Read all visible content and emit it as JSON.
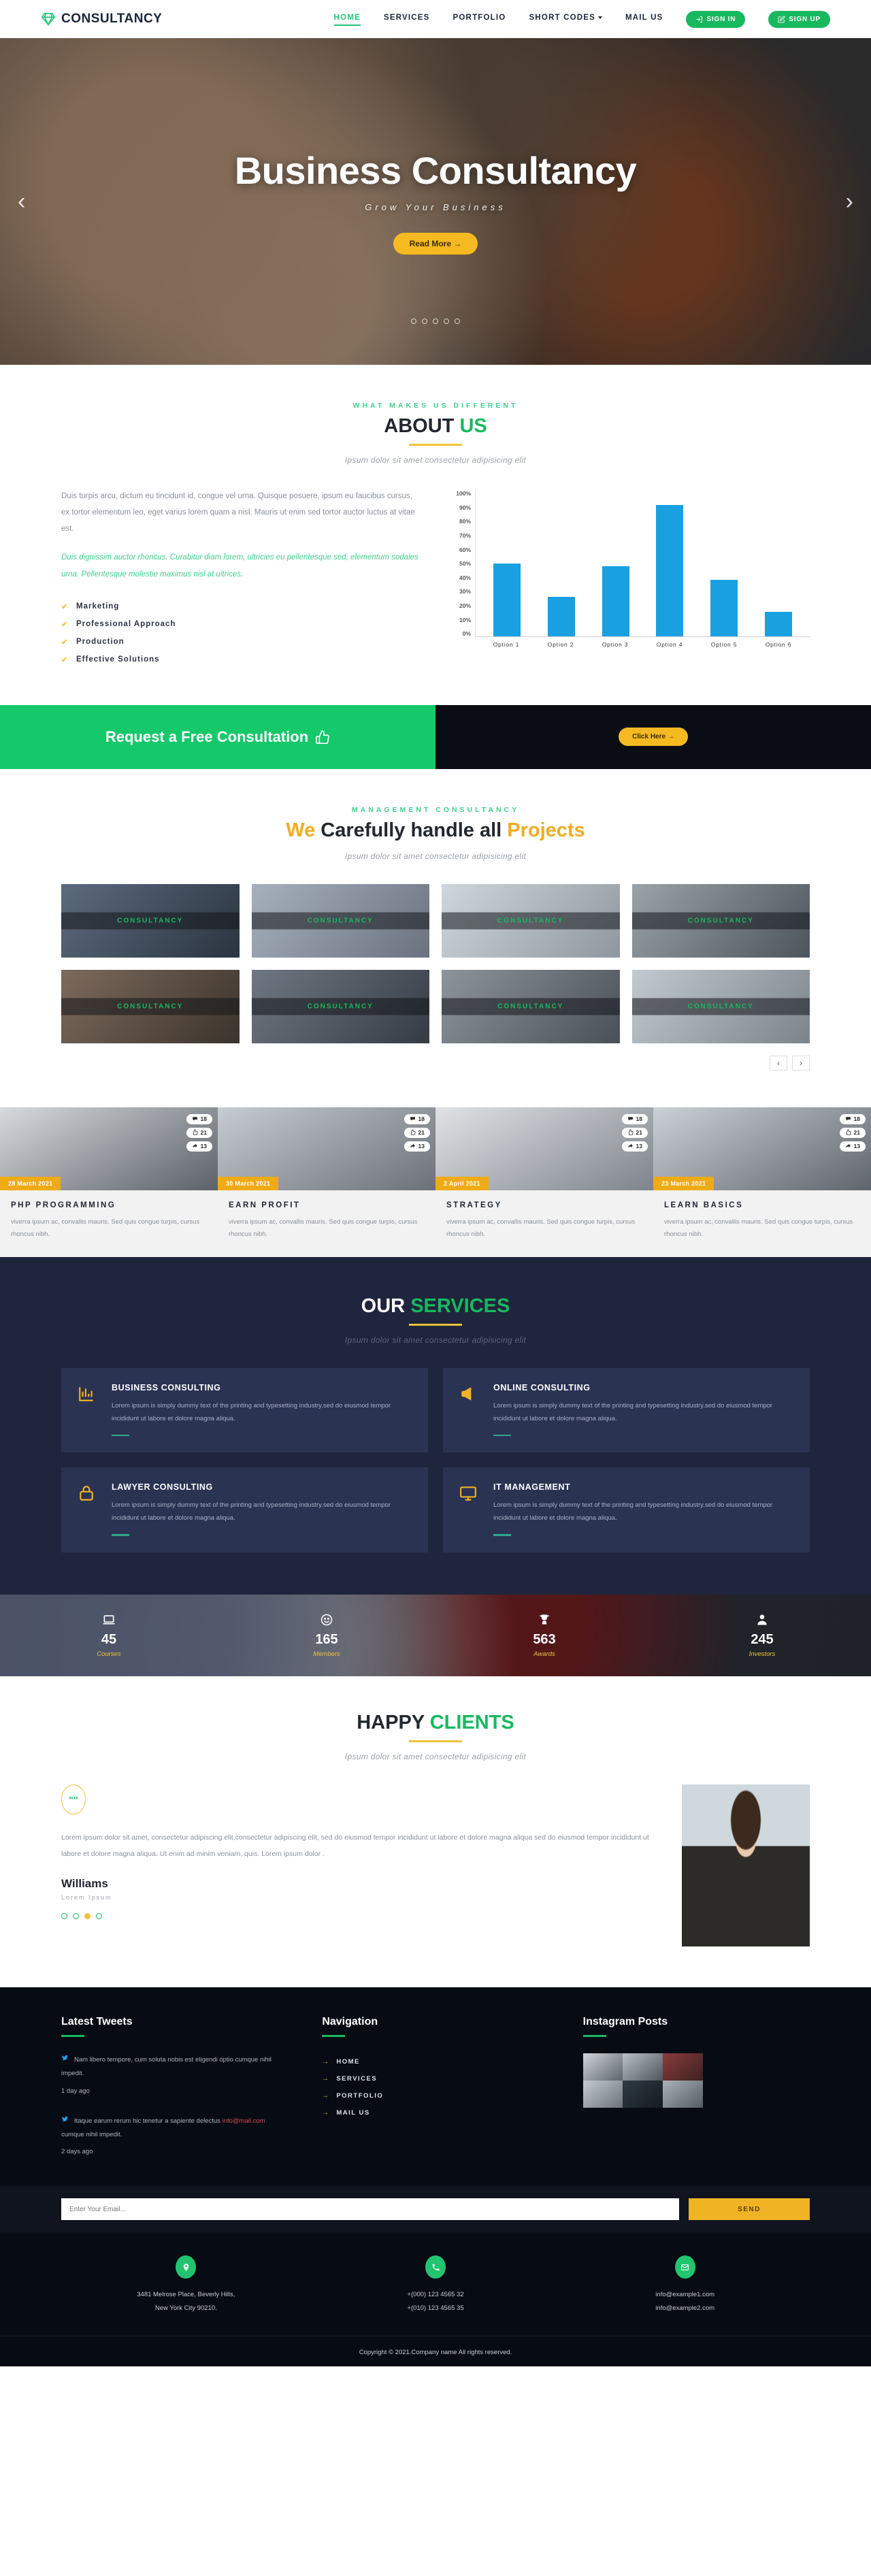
{
  "header": {
    "brand": "CONSULTANCY",
    "brand_icon": "diamond-icon",
    "nav": [
      {
        "label": "HOME",
        "active": true
      },
      {
        "label": "SERVICES",
        "active": false
      },
      {
        "label": "PORTFOLIO",
        "active": false
      },
      {
        "label": "SHORT CODES",
        "active": false,
        "dropdown": true
      },
      {
        "label": "MAIL US",
        "active": false
      }
    ],
    "sign_in": "SIGN IN",
    "sign_up": "SIGN UP"
  },
  "hero": {
    "title": "Business Consultancy",
    "subtitle": "Grow Your Business",
    "button": "Read More",
    "prev_icon": "chevron-left-icon",
    "next_icon": "chevron-right-icon",
    "dots": 5,
    "active_dot": 0
  },
  "about": {
    "eyebrow": "WHAT MAKES US DIFFERENT",
    "title_dark": "ABOUT",
    "title_accent": "US",
    "desc": "Ipsum dolor sit amet consectetur adipisicing elit",
    "paragraph1": "Duis turpis arcu, dictum eu tincidunt id, congue vel urna. Quisque posuere, ipsum eu faucibus cursus, ex tortor elementum leo, eget varius lorem quam a nisl. Mauris ut enim sed tortor auctor luctus at vitae est.",
    "paragraph2": "Duis dignissim auctor rhoncus. Curabitur diam lorem, ultricies eu pellentesque sed, elementum sodales urna. Pellentesque molestie maximus nisl at ultrices.",
    "list": [
      "Marketing",
      "Professional Approach",
      "Production",
      "Effective Solutions"
    ]
  },
  "chart_data": {
    "type": "bar",
    "categories": [
      "Option 1",
      "Option 2",
      "Option 3",
      "Option 4",
      "Option 5",
      "Option 6"
    ],
    "values": [
      50,
      27,
      48,
      90,
      39,
      17
    ],
    "title": "",
    "xlabel": "",
    "ylabel": "",
    "ylim": [
      0,
      100
    ],
    "ytick_labels": [
      "100%",
      "90%",
      "80%",
      "70%",
      "60%",
      "50%",
      "40%",
      "30%",
      "20%",
      "10%",
      "0%"
    ],
    "bar_color": "#18a0e0",
    "grid": false,
    "legend": "none"
  },
  "cta": {
    "text": "Request a Free Consultation",
    "thumb_icon": "thumbs-up-icon",
    "button": "Click Here"
  },
  "projects": {
    "eyebrow": "MANAGEMENT CONSULTANCY",
    "title_p1": "We",
    "title_p2": "Carefully handle all",
    "title_p3": "Projects",
    "desc": "Ipsum dolor sit amet consectetur adipisicing elit",
    "label": "CONSULTANCY",
    "items": [
      {
        "label": "CONSULTANCY"
      },
      {
        "label": "CONSULTANCY"
      },
      {
        "label": "CONSULTANCY"
      },
      {
        "label": "CONSULTANCY"
      },
      {
        "label": "CONSULTANCY"
      },
      {
        "label": "CONSULTANCY"
      },
      {
        "label": "CONSULTANCY"
      },
      {
        "label": "CONSULTANCY"
      }
    ],
    "prev_icon": "chevron-left-icon",
    "next_icon": "chevron-right-icon"
  },
  "blog": {
    "stat_icons": {
      "comments": "comment-icon",
      "likes": "thumbs-up-icon",
      "shares": "share-icon"
    },
    "posts": [
      {
        "date": "28 March 2021",
        "title": "PHP PROGRAMMING",
        "text": "viverra ipsum ac, convallis mauris. Sed quis congue turpis, cursus rhoncus nibh.",
        "comments": "18",
        "likes": "21",
        "shares": "13"
      },
      {
        "date": "30 March 2021",
        "title": "EARN PROFIT",
        "text": "viverra ipsum ac, convallis mauris. Sed quis congue turpis, cursus rhoncus nibh.",
        "comments": "18",
        "likes": "21",
        "shares": "13"
      },
      {
        "date": "2 April 2021",
        "title": "STRATEGY",
        "text": "viverra ipsum ac, convallis mauris. Sed quis congue turpis, cursus rhoncus nibh.",
        "comments": "18",
        "likes": "21",
        "shares": "13"
      },
      {
        "date": "23 March 2021",
        "title": "LEARN BASICS",
        "text": "viverra ipsum ac, convallis mauris. Sed quis congue turpis, cursus rhoncus nibh.",
        "comments": "18",
        "likes": "21",
        "shares": "13"
      }
    ]
  },
  "services": {
    "title_dark": "OUR",
    "title_accent": "SERVICES",
    "desc": "Ipsum dolor sit amet consectetur adipisicing elit",
    "body": "Lorem ipsum is simply dummy text of the printing and typesetting industry.sed do eiusmod tempor incididunt ut labore et dolore magna aliqua.",
    "cards": [
      {
        "name": "BUSINESS CONSULTING",
        "icon": "bar-chart-icon"
      },
      {
        "name": "ONLINE CONSULTING",
        "icon": "megaphone-icon"
      },
      {
        "name": "LAWYER CONSULTING",
        "icon": "lock-icon"
      },
      {
        "name": "IT MANAGEMENT",
        "icon": "monitor-icon"
      }
    ]
  },
  "counters": [
    {
      "value": "45",
      "label": "Courses",
      "icon": "laptop-icon"
    },
    {
      "value": "165",
      "label": "Members",
      "icon": "smiley-icon"
    },
    {
      "value": "563",
      "label": "Awards",
      "icon": "trophy-icon"
    },
    {
      "value": "245",
      "label": "Investors",
      "icon": "user-icon"
    }
  ],
  "testimonial": {
    "title_dark": "HAPPY",
    "title_accent": "CLIENTS",
    "desc": "Ipsum dolor sit amet consectetur adipisicing elit",
    "quote_icon": "quote-icon",
    "text": "Lorem ipsum dolor sit amet, consectetur adipiscing elit,consectetur adipiscing elit, sed do eiusmod tempor incididunt ut labore et dolore magna aliqua sed do eiusmod tempor incididunt ut labore et dolore magna aliqua. Ut enim ad minim veniam, quis. Lorem ipsum dolor .",
    "name": "Williams",
    "role": "Lorem Ipsum",
    "dots": 4,
    "active_dot": 2
  },
  "footer": {
    "tweets_title": "Latest Tweets",
    "nav_title": "Navigation",
    "instagram_title": "Instagram Posts",
    "twitter_icon": "twitter-icon",
    "tweets": [
      {
        "text": "Nam libero tempore, cum soluta nobis est eligendi optio cumque nihil impedit.",
        "link": "",
        "tail": "",
        "ago": "1 day ago"
      },
      {
        "text": "Itaque earum rerum hic tenetur a sapiente delectus ",
        "link": "info@mail.com",
        "tail": " cumque nihil impedit.",
        "ago": "2 days ago"
      }
    ],
    "nav_links": [
      "HOME",
      "SERVICES",
      "PORTFOLIO",
      "MAIL US"
    ],
    "newsletter_placeholder": "Enter Your Email...",
    "newsletter_button": "SEND",
    "contacts": [
      {
        "icon": "location-icon",
        "lines": [
          "3481 Melrose Place, Beverly Hills,",
          "New York City 90210."
        ]
      },
      {
        "icon": "phone-icon",
        "lines": [
          "+(000) 123 4565 32",
          "+(010) 123 4565 35"
        ]
      },
      {
        "icon": "mail-icon",
        "lines": [
          "info@example1.com",
          "info@example2.com"
        ]
      }
    ],
    "copyright": "Copyright © 2021.Company name All rights reserved."
  }
}
